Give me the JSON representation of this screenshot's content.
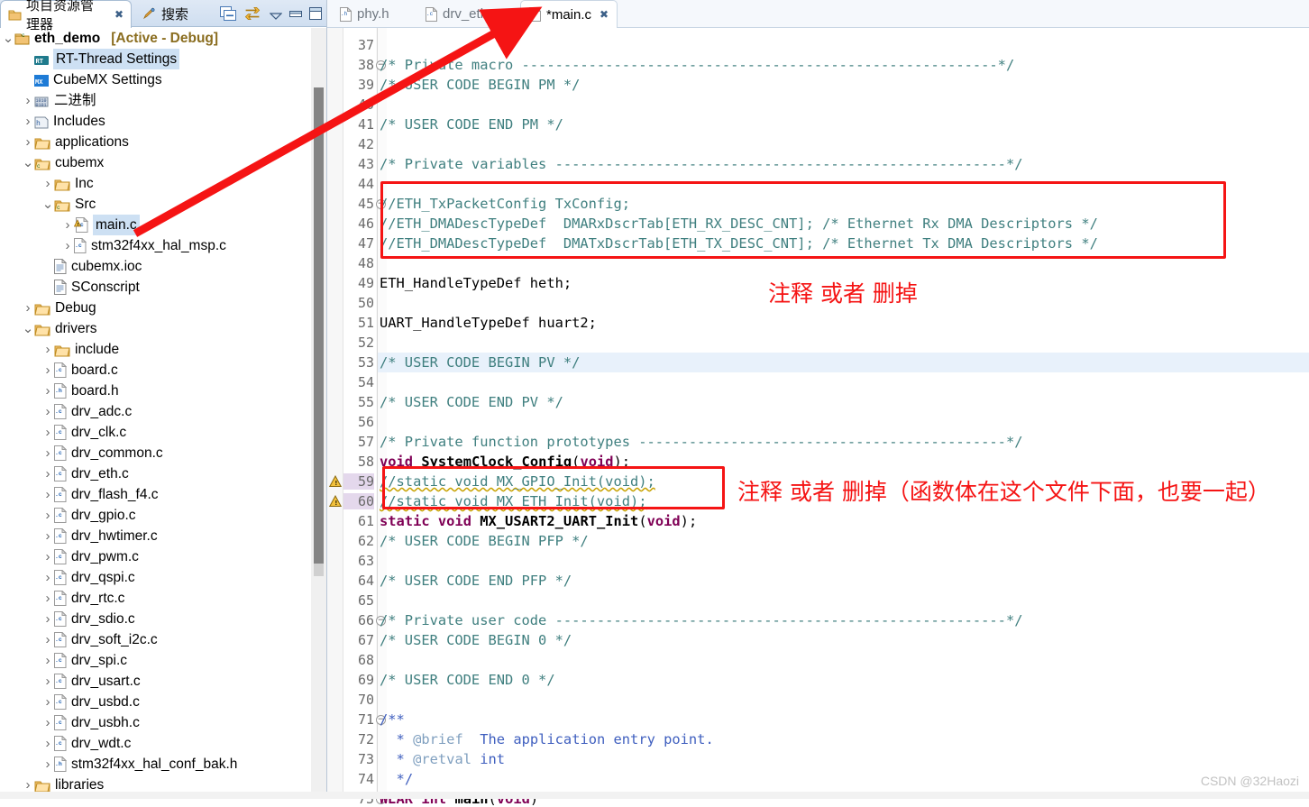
{
  "left_panel": {
    "tabs": [
      {
        "label": "项目资源管理器",
        "icon": "project-explorer-icon",
        "active": true,
        "closable": true
      },
      {
        "label": "搜索",
        "icon": "search-pencil-icon",
        "active": false,
        "closable": false
      }
    ],
    "toolbar": [
      {
        "name": "collapse-all-icon",
        "tooltip": "Collapse All"
      },
      {
        "name": "link-with-editor-icon",
        "tooltip": "Link with Editor"
      },
      {
        "name": "view-menu-icon",
        "tooltip": "View Menu"
      },
      {
        "name": "minimize-icon",
        "tooltip": "Minimize"
      },
      {
        "name": "maximize-icon",
        "tooltip": "Maximize"
      }
    ],
    "tree": [
      {
        "indent": 0,
        "arrow": "v",
        "icon": "project-icon",
        "label": "eth_demo",
        "bold": true,
        "suffix": "[Active - Debug]"
      },
      {
        "indent": 1,
        "arrow": "",
        "icon": "rt-thread-icon",
        "label": "RT-Thread Settings",
        "selected": true
      },
      {
        "indent": 1,
        "arrow": "",
        "icon": "cubemx-icon",
        "label": "CubeMX Settings"
      },
      {
        "indent": 1,
        "arrow": ">",
        "icon": "binary-icon",
        "label": "二进制"
      },
      {
        "indent": 1,
        "arrow": ">",
        "icon": "includes-icon",
        "label": "Includes"
      },
      {
        "indent": 1,
        "arrow": ">",
        "icon": "folder-icon",
        "label": "applications"
      },
      {
        "indent": 1,
        "arrow": "v",
        "icon": "folder-src-icon",
        "label": "cubemx"
      },
      {
        "indent": 2,
        "arrow": ">",
        "icon": "folder-icon",
        "label": "Inc"
      },
      {
        "indent": 2,
        "arrow": "v",
        "icon": "folder-src-icon",
        "label": "Src"
      },
      {
        "indent": 3,
        "arrow": ">",
        "icon": "c-file-warn-icon",
        "label": "main.c",
        "selected": true
      },
      {
        "indent": 3,
        "arrow": ">",
        "icon": "c-file-icon",
        "label": "stm32f4xx_hal_msp.c"
      },
      {
        "indent": 2,
        "arrow": "",
        "icon": "doc-icon",
        "label": "cubemx.ioc"
      },
      {
        "indent": 2,
        "arrow": "",
        "icon": "doc-icon",
        "label": "SConscript"
      },
      {
        "indent": 1,
        "arrow": ">",
        "icon": "folder-icon",
        "label": "Debug"
      },
      {
        "indent": 1,
        "arrow": "v",
        "icon": "folder-icon",
        "label": "drivers"
      },
      {
        "indent": 2,
        "arrow": ">",
        "icon": "folder-icon",
        "label": "include"
      },
      {
        "indent": 2,
        "arrow": ">",
        "icon": "c-file-icon",
        "label": "board.c"
      },
      {
        "indent": 2,
        "arrow": ">",
        "icon": "h-file-icon",
        "label": "board.h"
      },
      {
        "indent": 2,
        "arrow": ">",
        "icon": "c-file-icon",
        "label": "drv_adc.c"
      },
      {
        "indent": 2,
        "arrow": ">",
        "icon": "c-file-icon",
        "label": "drv_clk.c"
      },
      {
        "indent": 2,
        "arrow": ">",
        "icon": "c-file-icon",
        "label": "drv_common.c"
      },
      {
        "indent": 2,
        "arrow": ">",
        "icon": "c-file-icon",
        "label": "drv_eth.c"
      },
      {
        "indent": 2,
        "arrow": ">",
        "icon": "c-file-icon",
        "label": "drv_flash_f4.c"
      },
      {
        "indent": 2,
        "arrow": ">",
        "icon": "c-file-icon",
        "label": "drv_gpio.c"
      },
      {
        "indent": 2,
        "arrow": ">",
        "icon": "c-file-icon",
        "label": "drv_hwtimer.c"
      },
      {
        "indent": 2,
        "arrow": ">",
        "icon": "c-file-icon",
        "label": "drv_pwm.c"
      },
      {
        "indent": 2,
        "arrow": ">",
        "icon": "c-file-icon",
        "label": "drv_qspi.c"
      },
      {
        "indent": 2,
        "arrow": ">",
        "icon": "c-file-icon",
        "label": "drv_rtc.c"
      },
      {
        "indent": 2,
        "arrow": ">",
        "icon": "c-file-icon",
        "label": "drv_sdio.c"
      },
      {
        "indent": 2,
        "arrow": ">",
        "icon": "c-file-icon",
        "label": "drv_soft_i2c.c"
      },
      {
        "indent": 2,
        "arrow": ">",
        "icon": "c-file-icon",
        "label": "drv_spi.c"
      },
      {
        "indent": 2,
        "arrow": ">",
        "icon": "c-file-icon",
        "label": "drv_usart.c"
      },
      {
        "indent": 2,
        "arrow": ">",
        "icon": "c-file-icon",
        "label": "drv_usbd.c"
      },
      {
        "indent": 2,
        "arrow": ">",
        "icon": "c-file-icon",
        "label": "drv_usbh.c"
      },
      {
        "indent": 2,
        "arrow": ">",
        "icon": "c-file-icon",
        "label": "drv_wdt.c"
      },
      {
        "indent": 2,
        "arrow": ">",
        "icon": "h-file-icon",
        "label": "stm32f4xx_hal_conf_bak.h"
      },
      {
        "indent": 1,
        "arrow": ">",
        "icon": "folder-icon",
        "label": "libraries"
      }
    ]
  },
  "editor": {
    "tabs": [
      {
        "label": "phy.h",
        "icon": "h-file-icon",
        "active": false,
        "dirty": false
      },
      {
        "label": "drv_eth.c",
        "icon": "c-file-icon",
        "active": false,
        "dirty": false
      },
      {
        "label": "*main.c",
        "icon": "c-file-icon",
        "active": true,
        "dirty": true,
        "closable": true
      }
    ],
    "first_visible_line": 37,
    "lines": [
      {
        "n": 37,
        "text": ""
      },
      {
        "n": 38,
        "fold": true,
        "text": "/* Private macro ---------------------------------------------------------*/"
      },
      {
        "n": 39,
        "text": "/* USER CODE BEGIN PM */"
      },
      {
        "n": 40,
        "text": ""
      },
      {
        "n": 41,
        "text": "/* USER CODE END PM */"
      },
      {
        "n": 42,
        "text": ""
      },
      {
        "n": 43,
        "text": "/* Private variables ------------------------------------------------------*/"
      },
      {
        "n": 44,
        "text": ""
      },
      {
        "n": 45,
        "fold": true,
        "text": "//ETH_TxPacketConfig TxConfig;"
      },
      {
        "n": 46,
        "text": "//ETH_DMADescTypeDef  DMARxDscrTab[ETH_RX_DESC_CNT]; /* Ethernet Rx DMA Descriptors */"
      },
      {
        "n": 47,
        "text": "//ETH_DMADescTypeDef  DMATxDscrTab[ETH_TX_DESC_CNT]; /* Ethernet Tx DMA Descriptors */"
      },
      {
        "n": 48,
        "text": ""
      },
      {
        "n": 49,
        "text": "ETH_HandleTypeDef heth;"
      },
      {
        "n": 50,
        "text": ""
      },
      {
        "n": 51,
        "text": "UART_HandleTypeDef huart2;"
      },
      {
        "n": 52,
        "text": ""
      },
      {
        "n": 53,
        "text": "/* USER CODE BEGIN PV */",
        "highlight": true
      },
      {
        "n": 54,
        "text": ""
      },
      {
        "n": 55,
        "text": "/* USER CODE END PV */"
      },
      {
        "n": 56,
        "text": ""
      },
      {
        "n": 57,
        "text": "/* Private function prototypes --------------------------------------------*/"
      },
      {
        "n": 58,
        "text": "void SystemClock_Config(void);"
      },
      {
        "n": 59,
        "text": "//static void MX_GPIO_Init(void);",
        "warning": true
      },
      {
        "n": 60,
        "text": "//static void MX_ETH_Init(void);",
        "warning": true
      },
      {
        "n": 61,
        "text": "static void MX_USART2_UART_Init(void);"
      },
      {
        "n": 62,
        "text": "/* USER CODE BEGIN PFP */"
      },
      {
        "n": 63,
        "text": ""
      },
      {
        "n": 64,
        "text": "/* USER CODE END PFP */"
      },
      {
        "n": 65,
        "text": ""
      },
      {
        "n": 66,
        "fold": true,
        "text": "/* Private user code ------------------------------------------------------*/"
      },
      {
        "n": 67,
        "text": "/* USER CODE BEGIN 0 */"
      },
      {
        "n": 68,
        "text": ""
      },
      {
        "n": 69,
        "text": "/* USER CODE END 0 */"
      },
      {
        "n": 70,
        "text": ""
      },
      {
        "n": 71,
        "fold": true,
        "text": "/**"
      },
      {
        "n": 72,
        "text": "  * @brief  The application entry point."
      },
      {
        "n": 73,
        "text": "  * @retval int"
      },
      {
        "n": 74,
        "text": "  */"
      },
      {
        "n": 75,
        "fold": true,
        "text": "WEAK int main(void)"
      }
    ]
  },
  "annotations": {
    "arrow": {
      "name": "red-arrow",
      "from": "main.c tree node",
      "to": "*main.c editor tab"
    },
    "box1": {
      "covers_lines": "45-47"
    },
    "note1": "注释 或者 删掉",
    "box2": {
      "covers_lines": "59-60"
    },
    "note2": "注释 或者 删掉（函数体在这个文件下面，也要一起）"
  },
  "watermark": "CSDN @32Haozi",
  "colors": {
    "annotation_red": "#f51414",
    "comment_green": "#3f7f7f",
    "keyword_purple": "#7f0055",
    "javadoc_blue": "#3f5fbf",
    "selection_blue": "#cde0f3",
    "current_line": "#e8f1fb"
  }
}
